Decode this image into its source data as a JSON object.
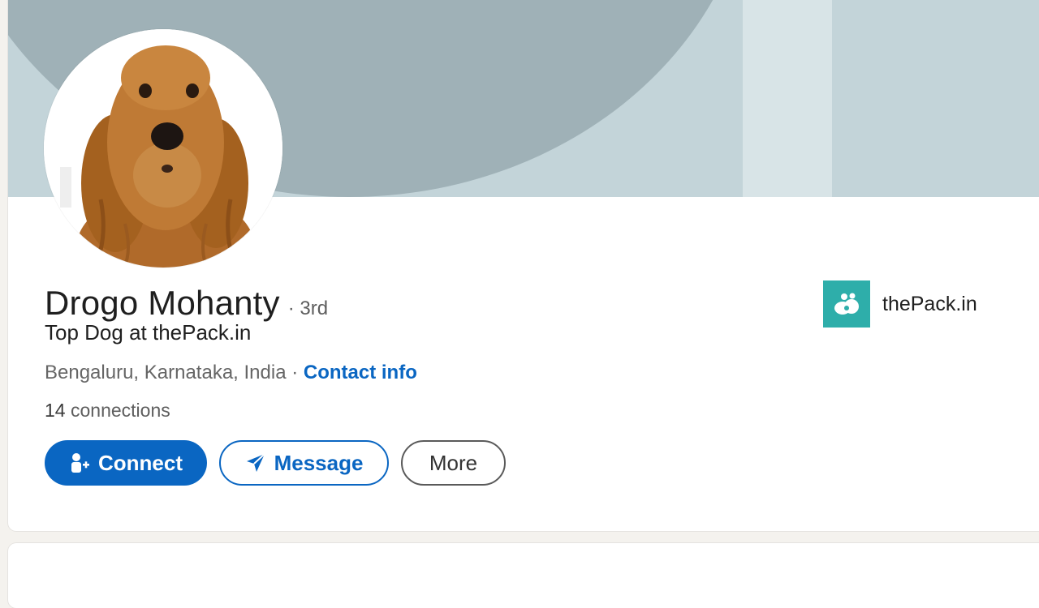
{
  "profile": {
    "name": "Drogo Mohanty",
    "degree": "· 3rd",
    "headline": "Top Dog at thePack.in",
    "location": "Bengaluru, Karnataka, India",
    "separator": " · ",
    "contact_label": "Contact info",
    "connections_count": "14",
    "connections_label": " connections"
  },
  "actions": {
    "connect_label": "Connect",
    "message_label": "Message",
    "more_label": "More"
  },
  "company": {
    "name": "thePack.in",
    "logo_icon": "paw-cloud-icon",
    "logo_color": "#2eaeaa"
  },
  "colors": {
    "accent": "#0a66c2",
    "banner": "#c3d4d9",
    "banner_shape": "#9fb1b7"
  },
  "icons": {
    "connect": "add-person-icon",
    "message": "send-icon",
    "avatar": "dog-photo"
  }
}
